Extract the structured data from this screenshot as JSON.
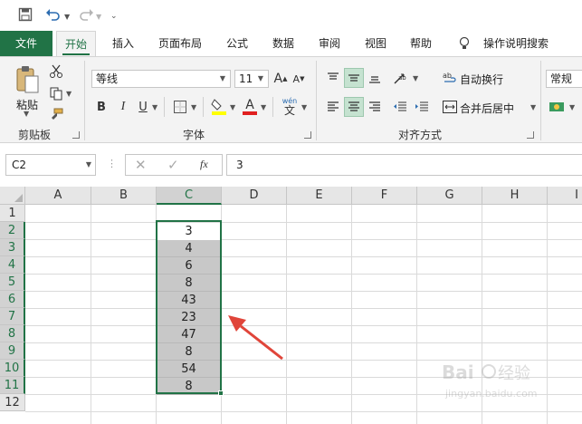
{
  "quick_access": {
    "icons": [
      "save-icon",
      "undo-icon",
      "redo-icon",
      "customize-icon"
    ]
  },
  "tabs": [
    {
      "label": "文件"
    },
    {
      "label": "开始"
    },
    {
      "label": "插入"
    },
    {
      "label": "页面布局"
    },
    {
      "label": "公式"
    },
    {
      "label": "数据"
    },
    {
      "label": "审阅"
    },
    {
      "label": "视图"
    },
    {
      "label": "帮助"
    },
    {
      "label": "操作说明搜索"
    }
  ],
  "ribbon": {
    "clipboard": {
      "paste_label": "粘贴",
      "group_label": "剪贴板"
    },
    "font": {
      "font_name": "等线",
      "font_size": "11",
      "bold": "B",
      "italic": "I",
      "underline": "U",
      "font_color_glyph": "A",
      "wen_glyph": "wén",
      "wen_char": "文",
      "grow_glyph": "A",
      "shrink_glyph": "A",
      "group_label": "字体"
    },
    "alignment": {
      "wrap_text": "自动换行",
      "merge_center": "合并后居中",
      "group_label": "对齐方式"
    },
    "number": {
      "format": "常规"
    }
  },
  "formula_bar": {
    "name_box": "C2",
    "fx_label": "fx",
    "formula": "3"
  },
  "grid": {
    "columns": [
      "A",
      "B",
      "C",
      "D",
      "E",
      "F",
      "G",
      "H",
      "I"
    ],
    "rows": [
      "1",
      "2",
      "3",
      "4",
      "5",
      "6",
      "7",
      "8",
      "9",
      "10",
      "11",
      "12"
    ],
    "selected_column": "C",
    "column_c_values": [
      "3",
      "4",
      "6",
      "8",
      "43",
      "23",
      "47",
      "8",
      "54",
      "8"
    ]
  },
  "colors": {
    "accent": "#217346",
    "arrow": "#e0453a",
    "selection_fill": "#c8c8c8"
  },
  "watermark": "Baidu 经验 jingyan.baidu.com"
}
